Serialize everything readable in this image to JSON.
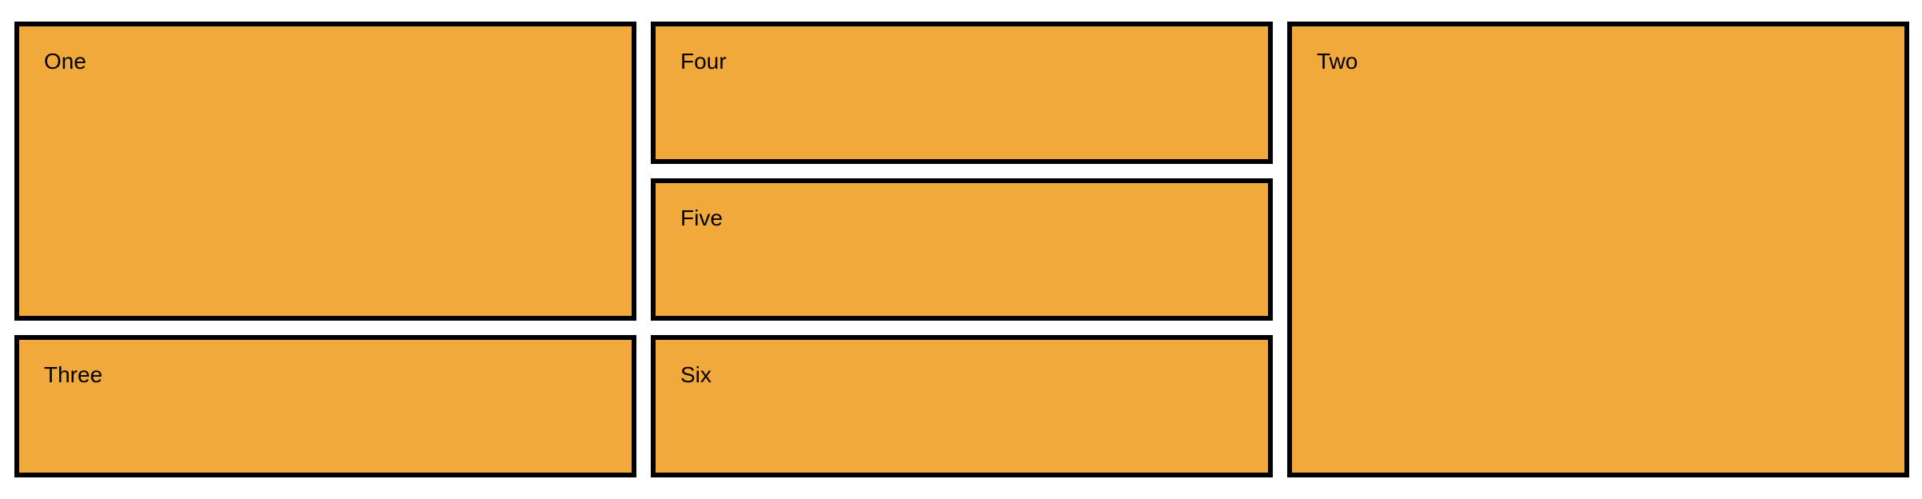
{
  "colors": {
    "box_fill": "#f2a93b",
    "box_border": "#000000",
    "background": "#ffffff"
  },
  "boxes": {
    "one": "One",
    "two": "Two",
    "three": "Three",
    "four": "Four",
    "five": "Five",
    "six": "Six"
  }
}
